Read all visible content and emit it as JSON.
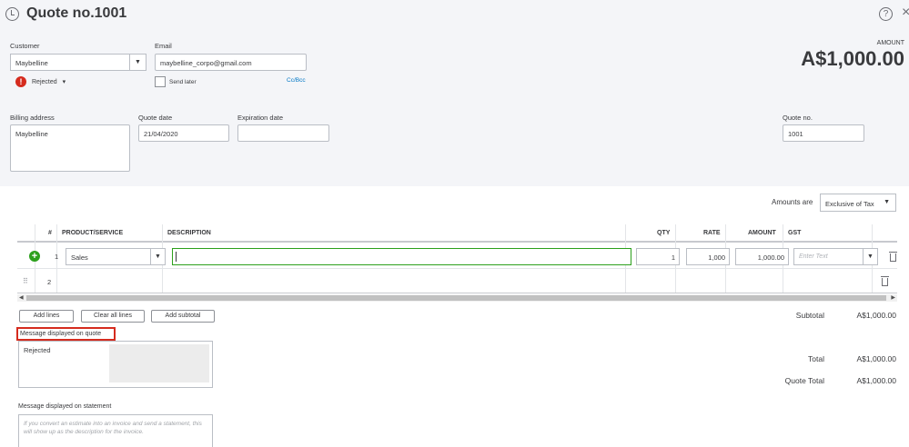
{
  "header": {
    "title": "Quote no.1001",
    "help_label": "?",
    "close_label": "×"
  },
  "customer": {
    "label": "Customer",
    "value": "Maybelline",
    "status": "Rejected"
  },
  "email": {
    "label": "Email",
    "value": "maybelline_corpo@gmail.com",
    "send_later": "Send later",
    "cc_bcc": "Cc/Bcc"
  },
  "amount": {
    "label": "AMOUNT",
    "value": "A$1,000.00"
  },
  "billing": {
    "label": "Billing address",
    "value": "Maybelline"
  },
  "quote_date": {
    "label": "Quote date",
    "value": "21/04/2020"
  },
  "expiration_date": {
    "label": "Expiration date",
    "value": ""
  },
  "quote_no": {
    "label": "Quote no.",
    "value": "1001"
  },
  "amounts_are": {
    "label": "Amounts are",
    "value": "Exclusive of Tax"
  },
  "table": {
    "headers": [
      "#",
      "PRODUCT/SERVICE",
      "DESCRIPTION",
      "QTY",
      "RATE",
      "AMOUNT",
      "GST"
    ],
    "rows": [
      {
        "num": "1",
        "product": "Sales",
        "description": "",
        "qty": "1",
        "rate": "1,000",
        "amount": "1,000.00",
        "gst_placeholder": "Enter Text"
      },
      {
        "num": "2",
        "product": "",
        "description": "",
        "qty": "",
        "rate": "",
        "amount": "",
        "gst_placeholder": ""
      }
    ]
  },
  "buttons": {
    "add_lines": "Add lines",
    "clear_all_lines": "Clear all lines",
    "add_subtotal": "Add subtotal"
  },
  "message_quote": {
    "label": "Message displayed on quote",
    "value": "Rejected"
  },
  "message_statement": {
    "label": "Message displayed on statement",
    "placeholder": "If you convert an estimate into an invoice and send a statement, this will show up as the description for the invoice."
  },
  "totals": {
    "subtotal_label": "Subtotal",
    "subtotal_value": "A$1,000.00",
    "total_label": "Total",
    "total_value": "A$1,000.00",
    "quote_total_label": "Quote Total",
    "quote_total_value": "A$1,000.00"
  },
  "colors": {
    "accent_green": "#2ca01c",
    "alert_red": "#d52b1e",
    "link_blue": "#0077c5"
  }
}
